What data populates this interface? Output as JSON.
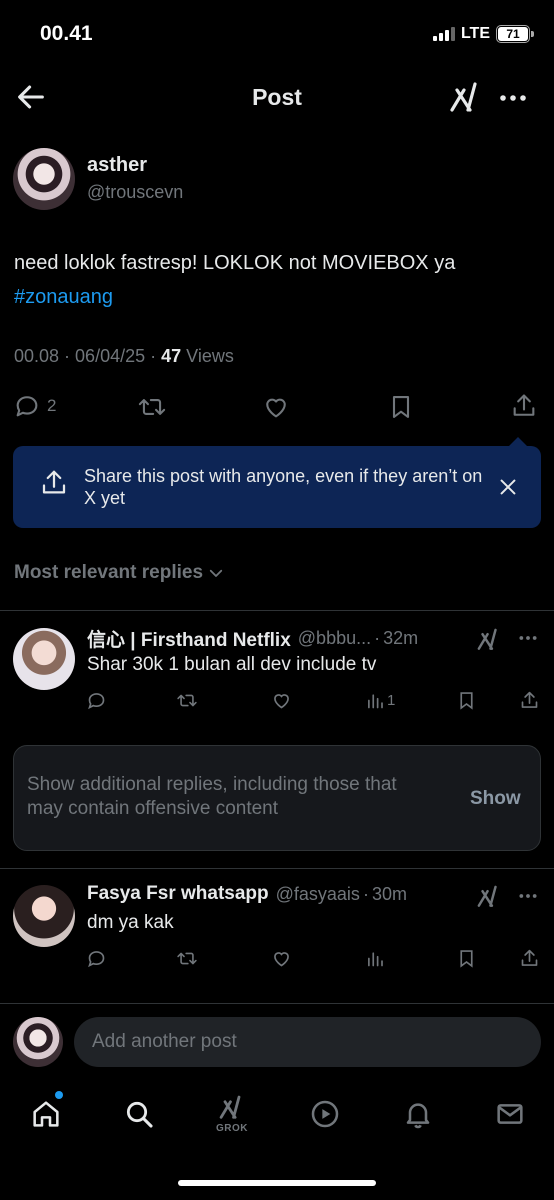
{
  "status_bar": {
    "time": "00.41",
    "network": "LTE",
    "battery": "71"
  },
  "header": {
    "title": "Post"
  },
  "post": {
    "author_name": "asther",
    "author_handle": "@trouscevn",
    "text": "need loklok fastresp! LOKLOK not MOVIEBOX ya",
    "hashtag": "#zonauang",
    "time": "00.08",
    "date": "06/04/25",
    "views_count": "47",
    "views_label": "Views",
    "reply_count": "2"
  },
  "share_banner": {
    "text": "Share this post with anyone, even if they aren’t on X yet"
  },
  "replies_filter": {
    "label": "Most relevant replies"
  },
  "replies": [
    {
      "name": "信心 | Firsthand Netflix",
      "handle": "@bbbu...",
      "age": "32m",
      "text": "Shar 30k 1 bulan all dev include tv",
      "views": "1"
    },
    {
      "name": "Fasya Fsr whatsapp",
      "handle": "@fasyaais",
      "age": "30m",
      "text": "dm ya kak",
      "views": ""
    }
  ],
  "hidden_replies": {
    "text": "Show additional replies, including those that may contain offensive content",
    "button": "Show"
  },
  "compose": {
    "placeholder": "Add another post"
  },
  "bottom_nav": {
    "grok_label": "GROK"
  },
  "colors": {
    "accent": "#1d9bf0",
    "banner_bg": "#0d2555",
    "muted": "#71767b",
    "text": "#e7e9ea"
  },
  "icons": [
    "back-arrow-icon",
    "grok-icon",
    "more-icon",
    "reply-icon",
    "repost-icon",
    "like-icon",
    "bookmark-icon",
    "share-icon",
    "chevron-down-icon",
    "views-icon",
    "home-icon",
    "search-icon",
    "play-icon",
    "bell-icon",
    "mail-icon"
  ]
}
